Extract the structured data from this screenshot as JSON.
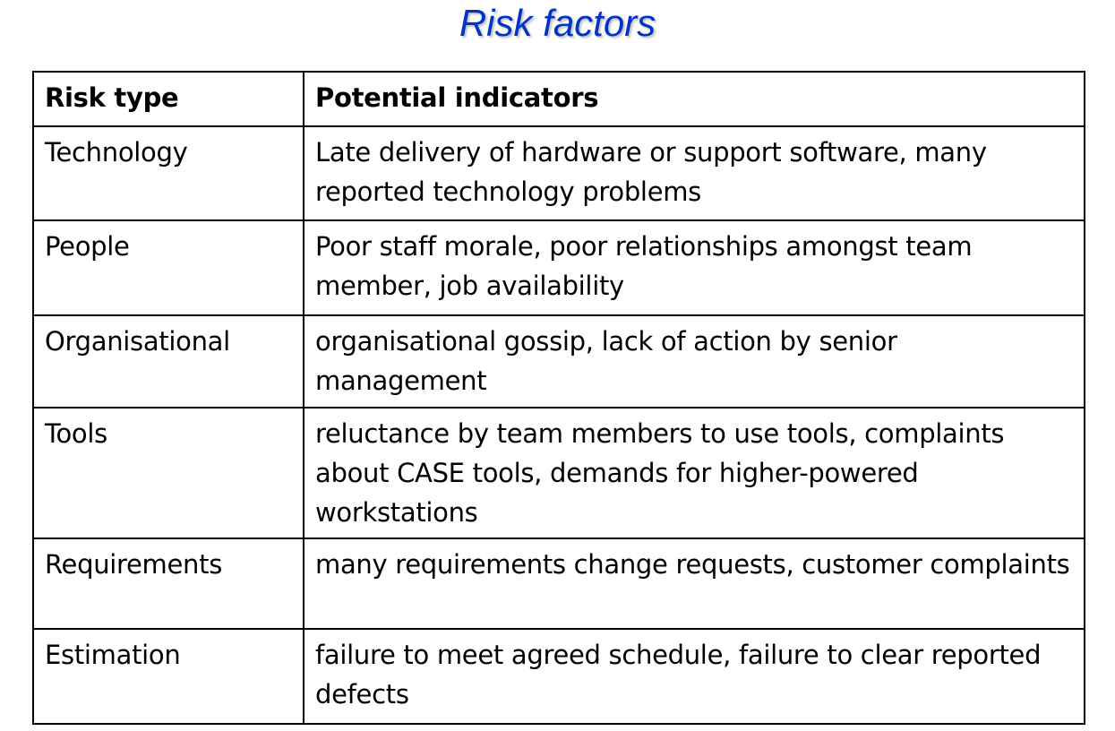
{
  "title": "Risk factors",
  "table": {
    "headers": [
      "Risk type",
      "Potential indicators"
    ],
    "rows": [
      {
        "type": "Technology",
        "indicators": "Late delivery of hardware or support software, many reported technology problems"
      },
      {
        "type": "People",
        "indicators": "Poor staff morale, poor relationships amongst team member, job availability"
      },
      {
        "type": "Organisational",
        "indicators": "organisational gossip, lack of action by senior management"
      },
      {
        "type": "Tools",
        "indicators": "reluctance by team members to use tools, complaints about CASE tools, demands for higher-powered workstations"
      },
      {
        "type": "Requirements",
        "indicators": "many requirements change requests, customer complaints"
      },
      {
        "type": "Estimation",
        "indicators": "failure to meet agreed schedule, failure to clear reported defects"
      }
    ]
  },
  "colors": {
    "title": "#0033cc"
  }
}
